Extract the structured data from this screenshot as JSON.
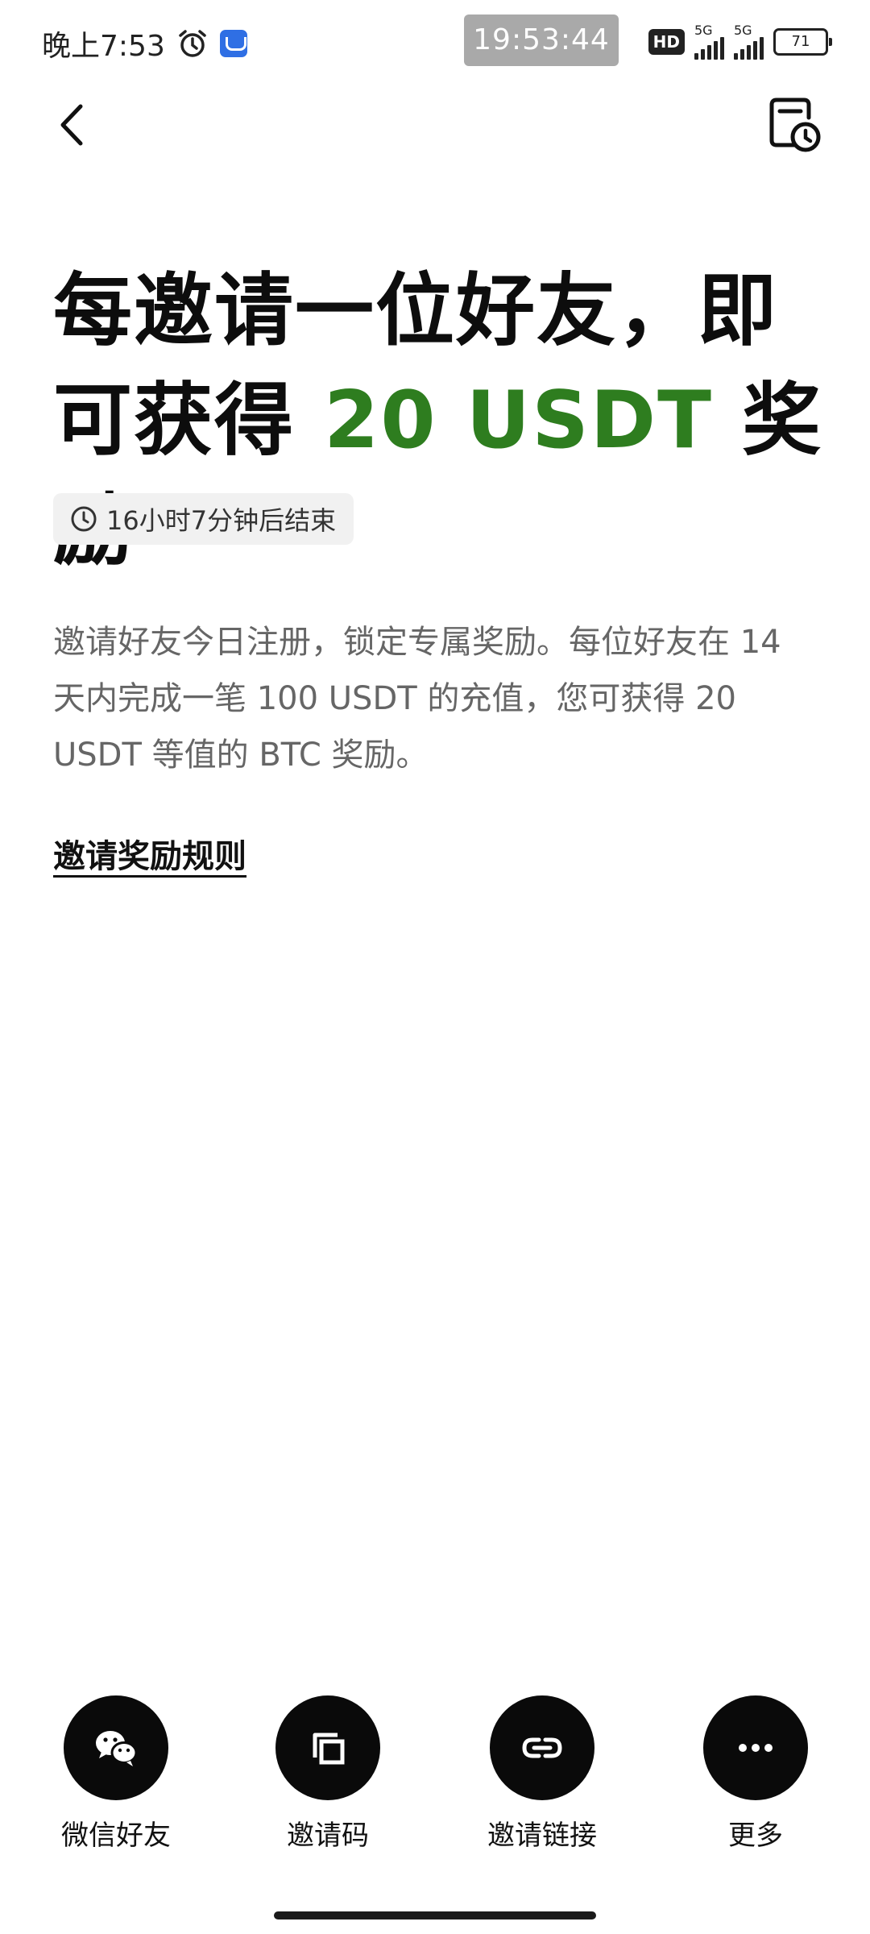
{
  "status_bar": {
    "time": "晚上7:53",
    "clock_overlay": "19:53:44",
    "hd_label": "HD",
    "signal_1_label": "5G",
    "signal_2_label": "5G",
    "battery": "71"
  },
  "header": {
    "back_icon": "chevron-left-icon",
    "history_icon": "document-clock-icon"
  },
  "headline": {
    "part1": "每邀请一位好友，即可获得 ",
    "accent": "20 USDT",
    "part2": " 奖励",
    "accent_color": "#2e7d1f"
  },
  "timer": {
    "icon": "clock-icon",
    "label": "16小时7分钟后结束"
  },
  "description": "邀请好友今日注册，锁定专属奖励。每位好友在 14 天内完成一笔 100 USDT 的充值，您可获得 20 USDT 等值的 BTC 奖励。",
  "rules_link": "邀请奖励规则",
  "share_actions": [
    {
      "label": "微信好友",
      "icon": "wechat-icon"
    },
    {
      "label": "邀请码",
      "icon": "copy-icon"
    },
    {
      "label": "邀请链接",
      "icon": "link-icon"
    },
    {
      "label": "更多",
      "icon": "more-dots-icon"
    }
  ]
}
